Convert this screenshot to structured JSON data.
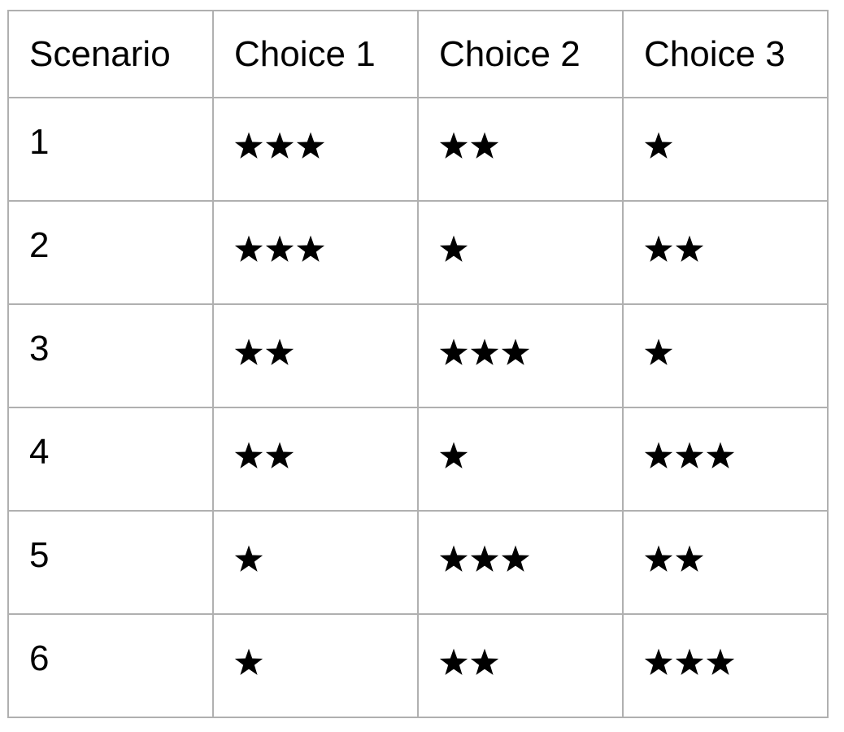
{
  "table": {
    "headers": [
      "Scenario",
      "Choice 1",
      "Choice 2",
      "Choice 3"
    ],
    "rows": [
      {
        "scenario": "1",
        "ratings": [
          3,
          2,
          1
        ]
      },
      {
        "scenario": "2",
        "ratings": [
          3,
          1,
          2
        ]
      },
      {
        "scenario": "3",
        "ratings": [
          2,
          3,
          1
        ]
      },
      {
        "scenario": "4",
        "ratings": [
          2,
          1,
          3
        ]
      },
      {
        "scenario": "5",
        "ratings": [
          1,
          3,
          2
        ]
      },
      {
        "scenario": "6",
        "ratings": [
          1,
          2,
          3
        ]
      }
    ],
    "rating_icon": "star-icon",
    "colors": {
      "border": "#b0b0b0",
      "text": "#000000",
      "star": "#000000",
      "background": "#ffffff"
    }
  }
}
